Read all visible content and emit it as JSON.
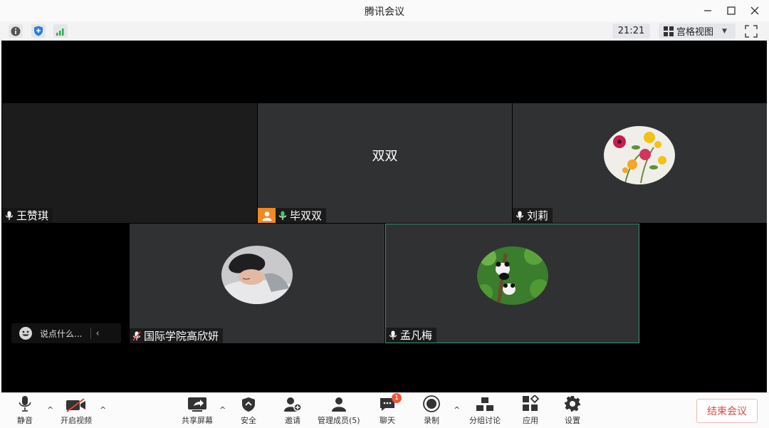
{
  "window": {
    "title": "腾讯会议",
    "minimize_icon": "minimize-icon",
    "maximize_icon": "maximize-icon",
    "close_icon": "close-icon"
  },
  "info_bar": {
    "time": "21:21",
    "view_label": "宫格视图",
    "icons": [
      "info-icon",
      "shield-icon",
      "signal-icon",
      "fullscreen-icon"
    ]
  },
  "participants": [
    {
      "name": "王赞琪",
      "mic": "on",
      "display": "blank"
    },
    {
      "name": "毕双双",
      "mic": "on",
      "display": "双双",
      "host": true
    },
    {
      "name": "刘莉",
      "mic": "on",
      "display": "avatar-flowers"
    },
    {
      "name": "国际学院高欣妍",
      "mic": "muted",
      "display": "avatar-girl"
    },
    {
      "name": "孟凡梅",
      "mic": "on",
      "display": "avatar-panda",
      "active": true
    }
  ],
  "chat": {
    "placeholder": "说点什么...",
    "collapse_icon": "chevron-left-icon"
  },
  "bottom_toolbar": {
    "mute": "静音",
    "video": "开启视频",
    "share": "共享屏幕",
    "security": "安全",
    "invite": "邀请",
    "members": "管理成员(5)",
    "chat": "聊天",
    "chat_badge": "1",
    "record": "录制",
    "breakout": "分组讨论",
    "apps": "应用",
    "settings": "设置",
    "end": "结束会议"
  },
  "colors": {
    "accent_green": "#2f9a7a",
    "host_orange": "#f08a24",
    "end_red": "#e5463a",
    "signal_green": "#27b14a"
  }
}
